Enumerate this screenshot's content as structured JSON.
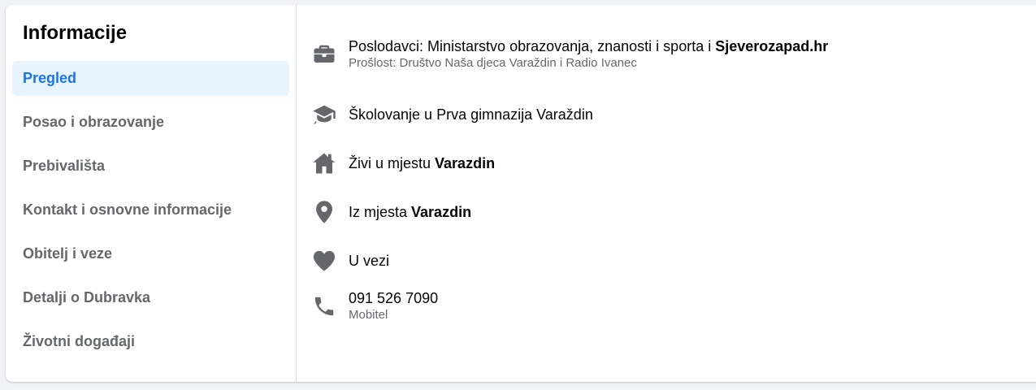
{
  "sidebar": {
    "title": "Informacije",
    "items": [
      {
        "label": "Pregled",
        "active": true
      },
      {
        "label": "Posao i obrazovanje",
        "active": false
      },
      {
        "label": "Prebivališta",
        "active": false
      },
      {
        "label": "Kontakt i osnovne informacije",
        "active": false
      },
      {
        "label": "Obitelj i veze",
        "active": false
      },
      {
        "label": "Detalji o Dubravka",
        "active": false
      },
      {
        "label": "Životni događaji",
        "active": false
      }
    ]
  },
  "overview": {
    "work": {
      "icon": "briefcase-icon",
      "prefix": "Poslodavci: Ministarstvo obrazovanja, znanosti i sporta i ",
      "link": "Sjeverozapad.hr",
      "sub": "Prošlost: Društvo Naša djeca Varaždin i Radio Ivanec"
    },
    "education": {
      "icon": "graduation-cap-icon",
      "text": "Školovanje u Prva gimnazija Varaždin"
    },
    "lives": {
      "icon": "home-icon",
      "prefix": "Živi u mjestu ",
      "link": "Varazdin"
    },
    "from": {
      "icon": "location-pin-icon",
      "prefix": "Iz mjesta ",
      "link": "Varazdin"
    },
    "relationship": {
      "icon": "heart-icon",
      "text": "U vezi"
    },
    "phone": {
      "icon": "phone-icon",
      "number": "091 526 7090",
      "type": "Mobitel"
    }
  },
  "colors": {
    "accent": "#1b74e4",
    "active_bg": "#e7f3ff",
    "icon": "#65676b"
  }
}
